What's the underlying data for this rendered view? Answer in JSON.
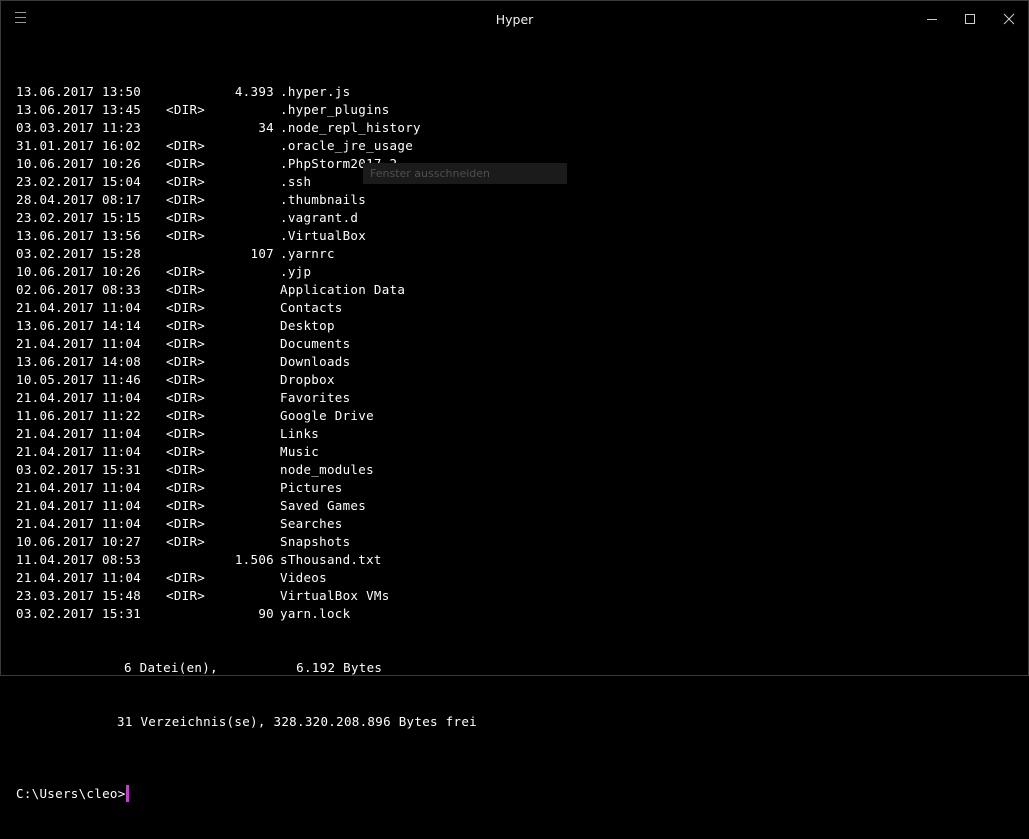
{
  "window": {
    "title": "Hyper",
    "icons": {
      "menu": "hamburger-menu-icon",
      "minimize": "minimize-icon",
      "maximize": "maximize-icon",
      "close": "close-icon"
    }
  },
  "listing": [
    {
      "date": "13.06.2017",
      "time": "13:50",
      "dir": "",
      "size": "4.393",
      "name": ".hyper.js"
    },
    {
      "date": "13.06.2017",
      "time": "13:45",
      "dir": "<DIR>",
      "size": "",
      "name": ".hyper_plugins"
    },
    {
      "date": "03.03.2017",
      "time": "11:23",
      "dir": "",
      "size": "34",
      "name": ".node_repl_history"
    },
    {
      "date": "31.01.2017",
      "time": "16:02",
      "dir": "<DIR>",
      "size": "",
      "name": ".oracle_jre_usage"
    },
    {
      "date": "10.06.2017",
      "time": "10:26",
      "dir": "<DIR>",
      "size": "",
      "name": ".PhpStorm2017.2"
    },
    {
      "date": "23.02.2017",
      "time": "15:04",
      "dir": "<DIR>",
      "size": "",
      "name": ".ssh"
    },
    {
      "date": "28.04.2017",
      "time": "08:17",
      "dir": "<DIR>",
      "size": "",
      "name": ".thumbnails"
    },
    {
      "date": "23.02.2017",
      "time": "15:15",
      "dir": "<DIR>",
      "size": "",
      "name": ".vagrant.d"
    },
    {
      "date": "13.06.2017",
      "time": "13:56",
      "dir": "<DIR>",
      "size": "",
      "name": ".VirtualBox"
    },
    {
      "date": "03.02.2017",
      "time": "15:28",
      "dir": "",
      "size": "107",
      "name": ".yarnrc"
    },
    {
      "date": "10.06.2017",
      "time": "10:26",
      "dir": "<DIR>",
      "size": "",
      "name": ".yjp"
    },
    {
      "date": "02.06.2017",
      "time": "08:33",
      "dir": "<DIR>",
      "size": "",
      "name": "Application Data"
    },
    {
      "date": "21.04.2017",
      "time": "11:04",
      "dir": "<DIR>",
      "size": "",
      "name": "Contacts"
    },
    {
      "date": "13.06.2017",
      "time": "14:14",
      "dir": "<DIR>",
      "size": "",
      "name": "Desktop"
    },
    {
      "date": "21.04.2017",
      "time": "11:04",
      "dir": "<DIR>",
      "size": "",
      "name": "Documents"
    },
    {
      "date": "13.06.2017",
      "time": "14:08",
      "dir": "<DIR>",
      "size": "",
      "name": "Downloads"
    },
    {
      "date": "10.05.2017",
      "time": "11:46",
      "dir": "<DIR>",
      "size": "",
      "name": "Dropbox"
    },
    {
      "date": "21.04.2017",
      "time": "11:04",
      "dir": "<DIR>",
      "size": "",
      "name": "Favorites"
    },
    {
      "date": "11.06.2017",
      "time": "11:22",
      "dir": "<DIR>",
      "size": "",
      "name": "Google Drive"
    },
    {
      "date": "21.04.2017",
      "time": "11:04",
      "dir": "<DIR>",
      "size": "",
      "name": "Links"
    },
    {
      "date": "21.04.2017",
      "time": "11:04",
      "dir": "<DIR>",
      "size": "",
      "name": "Music"
    },
    {
      "date": "03.02.2017",
      "time": "15:31",
      "dir": "<DIR>",
      "size": "",
      "name": "node_modules"
    },
    {
      "date": "21.04.2017",
      "time": "11:04",
      "dir": "<DIR>",
      "size": "",
      "name": "Pictures"
    },
    {
      "date": "21.04.2017",
      "time": "11:04",
      "dir": "<DIR>",
      "size": "",
      "name": "Saved Games"
    },
    {
      "date": "21.04.2017",
      "time": "11:04",
      "dir": "<DIR>",
      "size": "",
      "name": "Searches"
    },
    {
      "date": "10.06.2017",
      "time": "10:27",
      "dir": "<DIR>",
      "size": "",
      "name": "Snapshots"
    },
    {
      "date": "11.04.2017",
      "time": "08:53",
      "dir": "",
      "size": "1.506",
      "name": "sThousand.txt"
    },
    {
      "date": "21.04.2017",
      "time": "11:04",
      "dir": "<DIR>",
      "size": "",
      "name": "Videos"
    },
    {
      "date": "23.03.2017",
      "time": "15:48",
      "dir": "<DIR>",
      "size": "",
      "name": "VirtualBox VMs"
    },
    {
      "date": "03.02.2017",
      "time": "15:31",
      "dir": "",
      "size": "90",
      "name": "yarn.lock"
    }
  ],
  "summary": {
    "files_line": "6 Datei(en),          6.192 Bytes",
    "dirs_line": "31 Verzeichnis(se), 328.320.208.896 Bytes frei"
  },
  "prompt": "C:\\Users\\cleo>",
  "tooltip": "Fenster ausschneiden",
  "colors": {
    "background": "#000000",
    "text": "#ffffff",
    "cursor": "#c23fd1"
  }
}
